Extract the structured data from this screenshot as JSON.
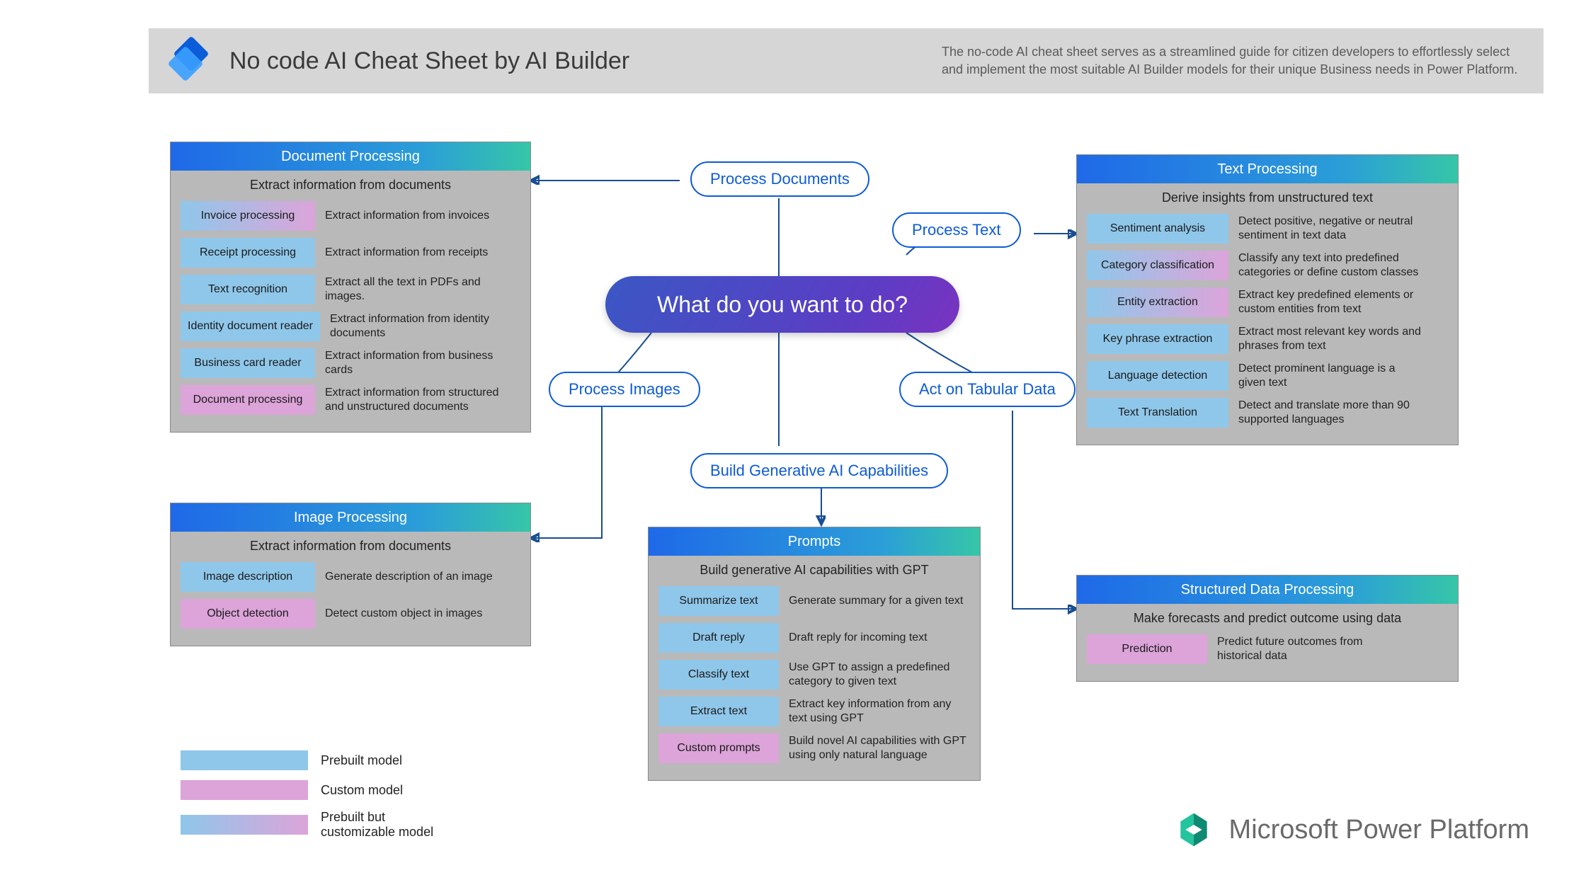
{
  "header": {
    "title": "No code AI Cheat Sheet by AI Builder",
    "desc": "The no-code AI cheat sheet serves as a streamlined guide for citizen developers to effortlessly select and implement the most suitable AI Builder models for their unique Business needs in Power Platform."
  },
  "hub": "What do you want to do?",
  "pills": {
    "docs": "Process Documents",
    "text": "Process Text",
    "images": "Process Images",
    "tabular": "Act on Tabular Data",
    "genai": "Build Generative AI Capabilities"
  },
  "cards": {
    "doc": {
      "title": "Document Processing",
      "sub": "Extract information from documents",
      "rows": [
        {
          "chip": "Invoice processing",
          "type": "mix",
          "desc": "Extract information from invoices"
        },
        {
          "chip": "Receipt processing",
          "type": "prebuilt",
          "desc": "Extract information from receipts"
        },
        {
          "chip": "Text  recognition",
          "type": "prebuilt",
          "desc": "Extract all the text in PDFs and images."
        },
        {
          "chip": "Identity document reader",
          "type": "prebuilt",
          "desc": "Extract information from identity documents"
        },
        {
          "chip": "Business card reader",
          "type": "prebuilt",
          "desc": "Extract information from business cards"
        },
        {
          "chip": "Document processing",
          "type": "custom",
          "desc": "Extract information from structured and unstructured documents"
        }
      ]
    },
    "img": {
      "title": "Image Processing",
      "sub": "Extract information from documents",
      "rows": [
        {
          "chip": "Image description",
          "type": "prebuilt",
          "desc": "Generate description of an image"
        },
        {
          "chip": "Object detection",
          "type": "custom",
          "desc": "Detect custom object in images"
        }
      ]
    },
    "prompts": {
      "title": "Prompts",
      "sub": "Build generative AI capabilities with GPT",
      "rows": [
        {
          "chip": "Summarize text",
          "type": "prebuilt",
          "desc": "Generate summary for a given text"
        },
        {
          "chip": "Draft reply",
          "type": "prebuilt",
          "desc": "Draft reply for incoming text"
        },
        {
          "chip": "Classify text",
          "type": "prebuilt",
          "desc": "Use GPT to assign a predefined category to given text"
        },
        {
          "chip": "Extract text",
          "type": "prebuilt",
          "desc": "Extract key information from any text using GPT"
        },
        {
          "chip": "Custom prompts",
          "type": "custom",
          "desc": "Build novel AI capabilities with GPT using only natural language"
        }
      ]
    },
    "text": {
      "title": "Text Processing",
      "sub": "Derive insights from unstructured text",
      "rows": [
        {
          "chip": "Sentiment analysis",
          "type": "prebuilt",
          "desc": "Detect positive, negative or neutral sentiment in text data"
        },
        {
          "chip": "Category classification",
          "type": "mix",
          "desc": "Classify any text into predefined categories or define custom classes"
        },
        {
          "chip": "Entity extraction",
          "type": "mix",
          "desc": "Extract key predefined elements or custom entities from text"
        },
        {
          "chip": "Key phrase extraction",
          "type": "prebuilt",
          "desc": "Extract most relevant key words and phrases from text"
        },
        {
          "chip": "Language detection",
          "type": "prebuilt",
          "desc": "Detect prominent language is a given text"
        },
        {
          "chip": "Text Translation",
          "type": "prebuilt",
          "desc": "Detect and translate more than 90 supported languages"
        }
      ]
    },
    "struct": {
      "title": "Structured Data Processing",
      "sub": "Make forecasts and predict outcome using data",
      "rows": [
        {
          "chip": "Prediction",
          "type": "custom",
          "desc": "Predict future outcomes from historical data"
        }
      ]
    }
  },
  "legend": {
    "prebuilt": "Prebuilt model",
    "custom": "Custom model",
    "mix": "Prebuilt but customizable model"
  },
  "brand": "Microsoft Power Platform"
}
